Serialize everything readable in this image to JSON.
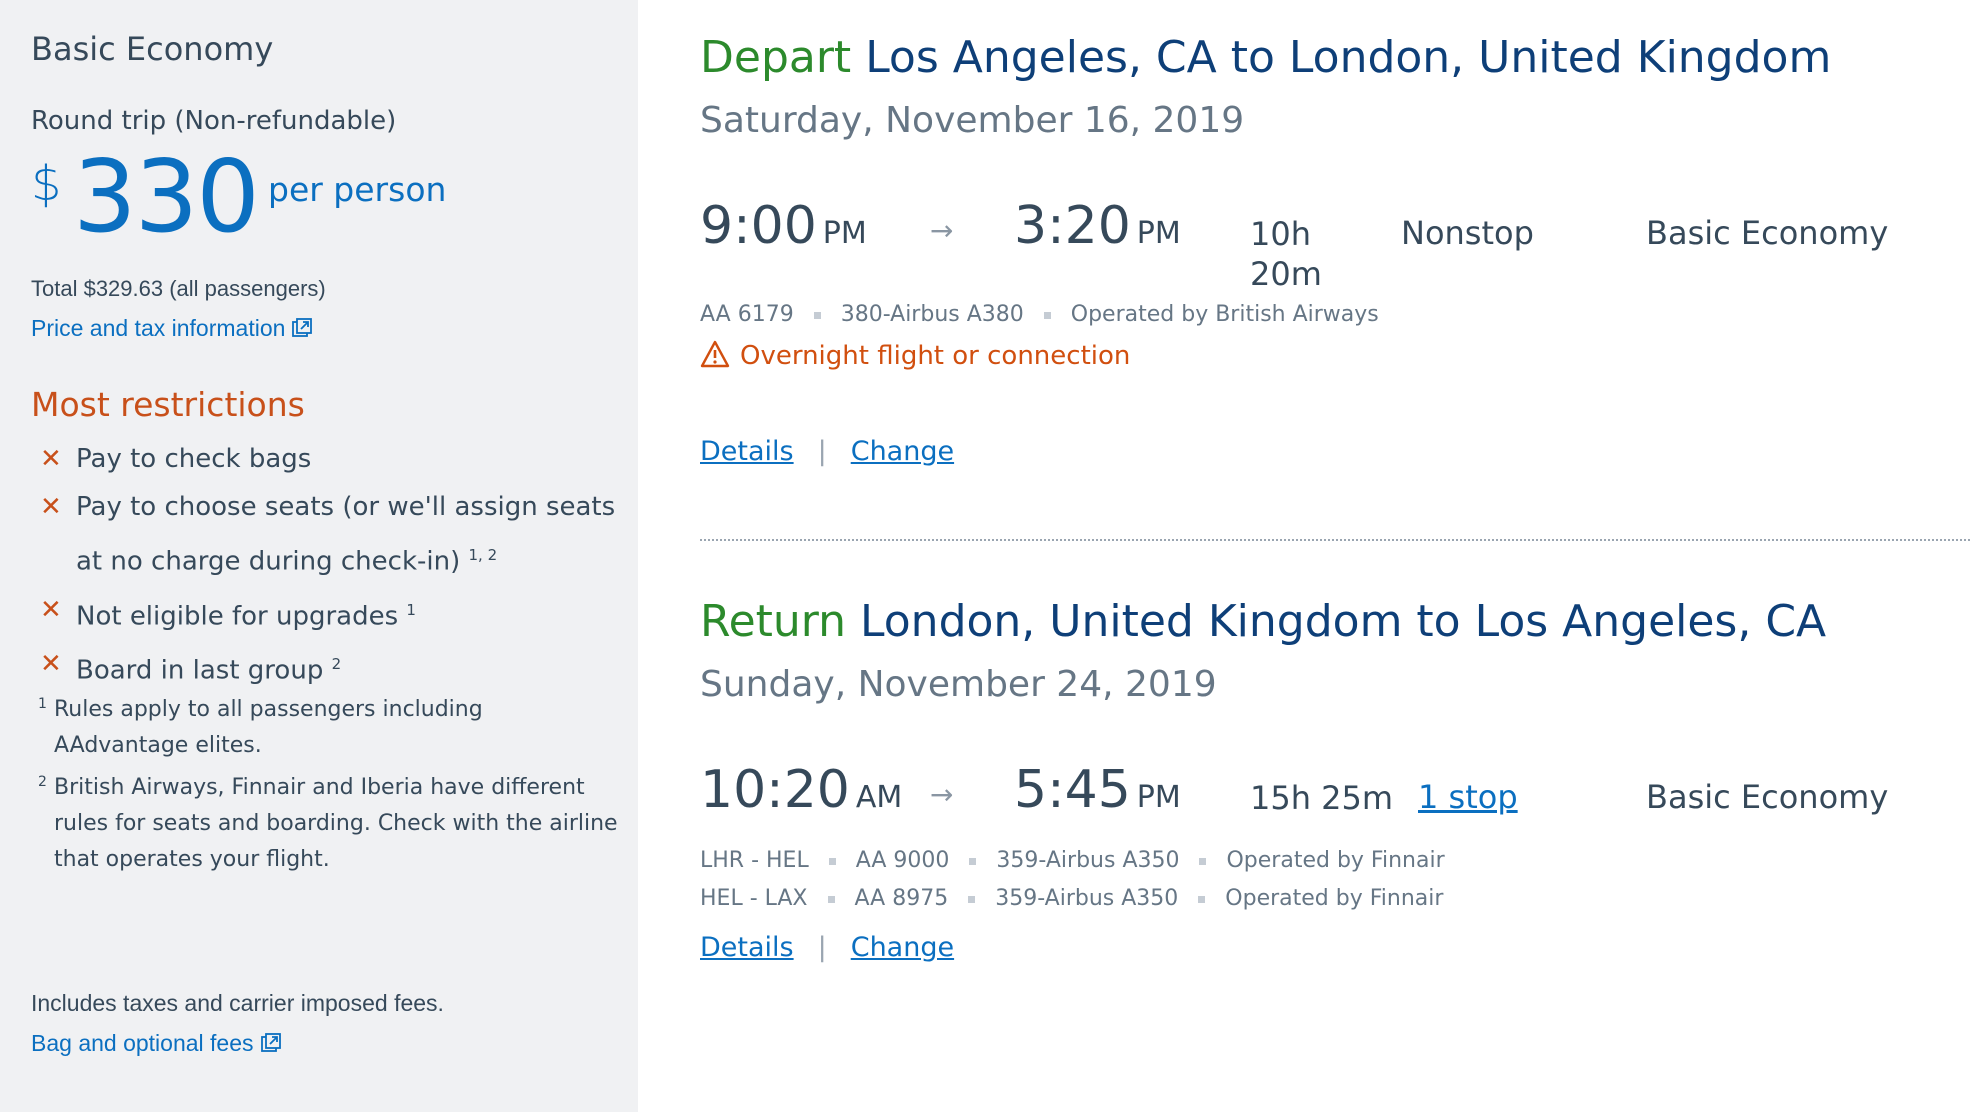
{
  "sidebar": {
    "fare_name": "Basic Economy",
    "trip_type": "Round trip (Non-refundable)",
    "price_currency": "$",
    "price_amount": "330",
    "price_per": "per person",
    "total": "Total $329.63 (all passengers)",
    "price_tax_link": "Price and tax information",
    "restrictions_title": "Most restrictions",
    "restrictions": [
      {
        "text": "Pay to check bags",
        "sup": ""
      },
      {
        "text": "Pay to choose seats (or we'll assign seats at no charge during check-in)",
        "sup": "1, 2"
      },
      {
        "text": "Not eligible for upgrades",
        "sup": "1"
      },
      {
        "text": "Board in last group",
        "sup": "2"
      }
    ],
    "footnotes": [
      {
        "num": "1",
        "text": "Rules apply to all passengers including AAdvantage elites."
      },
      {
        "num": "2",
        "text": "British Airways, Finnair and Iberia have different rules for seats and boarding. Check with the airline that operates your flight."
      }
    ],
    "includes": "Includes taxes and carrier imposed fees.",
    "bag_fees_link": "Bag and optional fees"
  },
  "depart": {
    "direction": "Depart",
    "route": "Los Angeles, CA to London, United Kingdom",
    "date": "Saturday, November 16, 2019",
    "dep_time": "9:00",
    "dep_ampm": "PM",
    "arrow": "→",
    "arr_time": "3:20",
    "arr_ampm": "PM",
    "duration_h": "10h",
    "duration_m": "20m",
    "stops": "Nonstop",
    "cabin": "Basic Economy",
    "segment": {
      "flight": "AA 6179",
      "aircraft": "380-Airbus A380",
      "operator": "Operated by British Airways"
    },
    "warning": "Overnight flight or connection",
    "details": "Details",
    "change": "Change",
    "pipe": "|"
  },
  "return": {
    "direction": "Return",
    "route": "London, United Kingdom to Los Angeles, CA",
    "date": "Sunday, November 24, 2019",
    "dep_time": "10:20",
    "dep_ampm": "AM",
    "arrow": "→",
    "arr_time": "5:45",
    "arr_ampm": "PM",
    "duration": "15h 25m",
    "stops": "1 stop",
    "cabin": "Basic Economy",
    "segments": [
      {
        "route": "LHR - HEL",
        "flight": "AA 9000",
        "aircraft": "359-Airbus A350",
        "operator": "Operated by Finnair"
      },
      {
        "route": "HEL - LAX",
        "flight": "AA 8975",
        "aircraft": "359-Airbus A350",
        "operator": "Operated by Finnair"
      }
    ],
    "details": "Details",
    "change": "Change",
    "pipe": "|"
  },
  "colors": {
    "accent_blue": "#0b6fc0",
    "title_navy": "#0e3f78",
    "direction_green": "#2c8a2c",
    "warning_orange": "#d14f0f",
    "sidebar_bg": "#f0f1f3"
  },
  "icons": {
    "external_link": "external-link-icon",
    "warning": "warning-triangle-icon",
    "restriction": "x-icon"
  }
}
